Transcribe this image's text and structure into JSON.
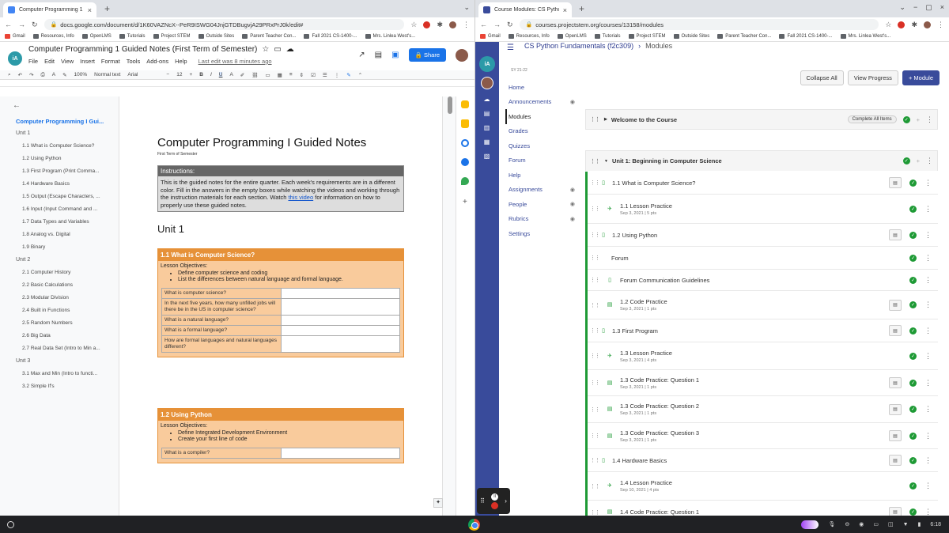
{
  "left_browser": {
    "tab_title": "Computer Programming 1 Guided",
    "url": "docs.google.com/document/d/1K60VAZNcX--PeR9ISWG04JnjGTDBugvjA29PRxPrJ0k/edit#",
    "bookmarks": [
      "Gmail",
      "Resources, Info",
      "OpenLMS",
      "Tutorials",
      "Project STEM",
      "Outside Sites",
      "Parent Teacher Con...",
      "Fall 2021 CS-1400-...",
      "Mrs. Linlea West's..."
    ],
    "doc_title": "Computer Programming 1 Guided Notes (First Term of Semester)",
    "menus": [
      "File",
      "Edit",
      "View",
      "Insert",
      "Format",
      "Tools",
      "Add-ons",
      "Help"
    ],
    "last_edit": "Last edit was 8 minutes ago",
    "share_label": "Share",
    "toolbar": {
      "zoom": "100%",
      "style": "Normal text",
      "font": "Arial",
      "size": "12"
    },
    "outline": [
      {
        "level": "h1",
        "text": "Computer Programming I Gui..."
      },
      {
        "level": "h2",
        "text": "Unit 1"
      },
      {
        "level": "h3",
        "text": "1.1 What is Computer Science?"
      },
      {
        "level": "h3",
        "text": "1.2 Using Python"
      },
      {
        "level": "h3",
        "text": "1.3 First Program (Print Comma..."
      },
      {
        "level": "h3",
        "text": "1.4 Hardware Basics"
      },
      {
        "level": "h3",
        "text": "1.5 Output (Escape Characters, ..."
      },
      {
        "level": "h3",
        "text": "1.6 Input (Input Command and ..."
      },
      {
        "level": "h3",
        "text": "1.7 Data Types and Variables"
      },
      {
        "level": "h3",
        "text": "1.8 Analog vs. Digital"
      },
      {
        "level": "h3",
        "text": "1.9 Binary"
      },
      {
        "level": "h2",
        "text": "Unit 2"
      },
      {
        "level": "h3",
        "text": "2.1 Computer History"
      },
      {
        "level": "h3",
        "text": "2.2 Basic Calculations"
      },
      {
        "level": "h3",
        "text": "2.3 Modular Division"
      },
      {
        "level": "h3",
        "text": "2.4 Built in Functions"
      },
      {
        "level": "h3",
        "text": "2.5 Random Numbers"
      },
      {
        "level": "h3",
        "text": "2.6 Big Data"
      },
      {
        "level": "h3",
        "text": "2.7 Real Data Set (Intro to Min a..."
      },
      {
        "level": "h2",
        "text": "Unit 3"
      },
      {
        "level": "h3",
        "text": "3.1 Max and Min (Intro to functi..."
      },
      {
        "level": "h3",
        "text": "3.2 Simple If's"
      }
    ],
    "page": {
      "title": "Computer Programming I Guided Notes",
      "subtitle": "First Term of Semester",
      "instructions_header": "Instructions:",
      "instructions_text": "This is the guided notes for the entire quarter. Each week's requirements are in a different color. Fill in the answers in the empty boxes while watching the videos and working through the instruction materials for each section. Watch ",
      "instructions_link": "this video",
      "instructions_tail": " for information on how to properly use these guided notes.",
      "unit_heading": "Unit 1",
      "sections": [
        {
          "title": "1.1 What is Computer Science?",
          "objectives_label": "Lesson Objectives:",
          "objectives": [
            "Define computer science and coding",
            "List the differences between natural language and formal language."
          ],
          "questions": [
            "What is computer science?",
            "In the next five years, how many unfilled jobs will there be in the US in computer science?",
            "What is a natural language?",
            "What is a formal language?",
            "How are formal languages and natural languages different?"
          ]
        },
        {
          "title": "1.2 Using Python",
          "objectives_label": "Lesson Objectives:",
          "objectives": [
            "Define Integrated Development Environment",
            "Create your first line of code"
          ],
          "questions": [
            "What is a compiler?"
          ]
        }
      ]
    }
  },
  "right_browser": {
    "tab_title": "Course Modules: CS Python Fun",
    "url": "courses.projectstem.org/courses/13158/modules",
    "bookmarks": [
      "Gmail",
      "Resources, Info",
      "OpenLMS",
      "Tutorials",
      "Project STEM",
      "Outside Sites",
      "Parent Teacher Con...",
      "Fall 2021 CS-1400-...",
      "Mrs. Linlea West's..."
    ],
    "breadcrumb": {
      "course": "CS Python Fundamentals (f2c309)",
      "page": "Modules"
    },
    "term": "SY 21-22",
    "nav": [
      {
        "label": "Home",
        "hidden": false,
        "active": false
      },
      {
        "label": "Announcements",
        "hidden": true,
        "active": false
      },
      {
        "label": "Modules",
        "hidden": false,
        "active": true
      },
      {
        "label": "Grades",
        "hidden": false,
        "active": false
      },
      {
        "label": "Quizzes",
        "hidden": false,
        "active": false
      },
      {
        "label": "Forum",
        "hidden": false,
        "active": false
      },
      {
        "label": "Help",
        "hidden": false,
        "active": false
      },
      {
        "label": "Assignments",
        "hidden": true,
        "active": false
      },
      {
        "label": "People",
        "hidden": true,
        "active": false
      },
      {
        "label": "Rubrics",
        "hidden": true,
        "active": false
      },
      {
        "label": "Settings",
        "hidden": false,
        "active": false
      }
    ],
    "buttons": {
      "collapse": "Collapse All",
      "progress": "View Progress",
      "add": "+ Module"
    },
    "modules": [
      {
        "title": "Welcome to the Course",
        "complete_all": "Complete All Items"
      },
      {
        "title": "Unit 1: Beginning in Computer Science"
      }
    ],
    "items": [
      {
        "title": "1.1 What is Computer Science?",
        "meta": "",
        "kind": "page",
        "indent": 0,
        "grade": true,
        "h": 29
      },
      {
        "title": "1.1 Lesson Practice",
        "meta": "Sep 3, 2021  |  5 pts",
        "kind": "quiz",
        "indent": 1,
        "grade": false,
        "h": 37
      },
      {
        "title": "1.2 Using Python",
        "meta": "",
        "kind": "page",
        "indent": 0,
        "grade": true,
        "h": 29
      },
      {
        "title": "Forum",
        "meta": "",
        "kind": "header",
        "indent": 0,
        "grade": false,
        "h": 29
      },
      {
        "title": "Forum Communication Guidelines",
        "meta": "",
        "kind": "page",
        "indent": 1,
        "grade": false,
        "h": 27
      },
      {
        "title": "1.2 Code Practice",
        "meta": "Sep 3, 2021  |  1 pts",
        "kind": "assign",
        "indent": 1,
        "grade": true,
        "h": 36
      },
      {
        "title": "1.3 First Program",
        "meta": "",
        "kind": "page",
        "indent": 0,
        "grade": true,
        "h": 29
      },
      {
        "title": "1.3 Lesson Practice",
        "meta": "Sep 3, 2021  |  4 pts",
        "kind": "quiz",
        "indent": 1,
        "grade": false,
        "h": 35
      },
      {
        "title": "1.3 Code Practice: Question 1",
        "meta": "Sep 3, 2021  |  1 pts",
        "kind": "assign",
        "indent": 1,
        "grade": true,
        "h": 33
      },
      {
        "title": "1.3 Code Practice: Question 2",
        "meta": "Sep 3, 2021  |  1 pts",
        "kind": "assign",
        "indent": 1,
        "grade": true,
        "h": 34
      },
      {
        "title": "1.3 Code Practice: Question 3",
        "meta": "Sep 3, 2021  |  1 pts",
        "kind": "assign",
        "indent": 1,
        "grade": true,
        "h": 33
      },
      {
        "title": "1.4 Hardware Basics",
        "meta": "",
        "kind": "page",
        "indent": 0,
        "grade": true,
        "h": 29
      },
      {
        "title": "1.4 Lesson Practice",
        "meta": "Sep 10, 2021  |  4 pts",
        "kind": "quiz",
        "indent": 1,
        "grade": false,
        "h": 36
      },
      {
        "title": "1.4 Code Practice: Question 1",
        "meta": "",
        "kind": "assign",
        "indent": 1,
        "grade": true,
        "h": 30
      }
    ]
  },
  "taskbar": {
    "time": "6:18"
  },
  "colors": {
    "docs_blue": "#1a73e8",
    "canvas_nav": "#394b9b",
    "orange": "#e69138",
    "peach": "#f9cb9c",
    "green": "#1e9a35"
  }
}
